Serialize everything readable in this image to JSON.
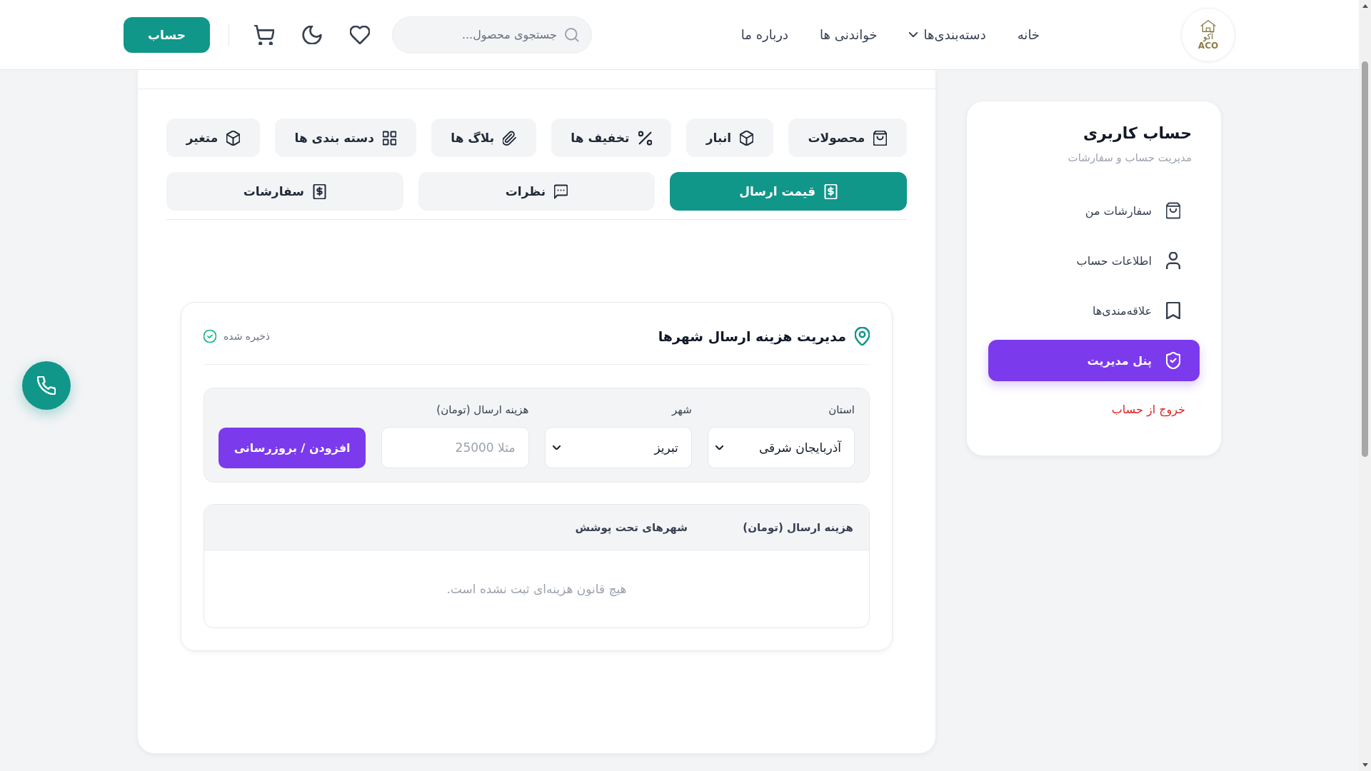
{
  "header": {
    "logo": {
      "name": "آکو",
      "latin": "ACO"
    },
    "nav": [
      {
        "label": "خانه",
        "has_dropdown": false
      },
      {
        "label": "دسته‌بندی‌ها",
        "has_dropdown": true
      },
      {
        "label": "خواندنی ها",
        "has_dropdown": false
      },
      {
        "label": "درباره ما",
        "has_dropdown": false
      }
    ],
    "search": {
      "placeholder": "جستجوی محصول..."
    },
    "account_button": "حساب"
  },
  "sidebar": {
    "title": "حساب کاربری",
    "subtitle": "مدیریت حساب و سفارشات",
    "items": [
      {
        "label": "سفارشات من",
        "selected": false
      },
      {
        "label": "اطلاعات حساب",
        "selected": false
      },
      {
        "label": "علاقه‌مندی‌ها",
        "selected": false
      },
      {
        "label": "پنل مدیریت",
        "selected": true
      }
    ],
    "logout": "خروج از حساب"
  },
  "admin_panel": {
    "tab_rows": [
      [
        {
          "label": "محصولات",
          "selected": false
        },
        {
          "label": "انبار",
          "selected": false
        },
        {
          "label": "تخفیف ها",
          "selected": false
        },
        {
          "label": "بلاگ ها",
          "selected": false
        },
        {
          "label": "دسته بندی ها",
          "selected": false
        },
        {
          "label": "متغیر",
          "selected": false
        }
      ],
      [
        {
          "label": "قیمت ارسال",
          "selected": true
        },
        {
          "label": "نظرات",
          "selected": false
        },
        {
          "label": "سفارشات",
          "selected": false
        }
      ]
    ],
    "shipping_card": {
      "title": "مدیریت هزینه ارسال شهرها",
      "status": "ذخیره شده",
      "form": {
        "province": {
          "label": "استان",
          "value": "آذربایجان شرقی"
        },
        "city": {
          "label": "شهر",
          "value": "تبریز"
        },
        "cost": {
          "label": "هزینه ارسال (تومان)",
          "placeholder": "مثلا 25000"
        },
        "submit_button": "افزودن / بروزرسانی"
      },
      "table": {
        "columns": [
          "هزینه ارسال (تومان)",
          "شهرهای تحت پوشش"
        ],
        "empty_message": "هیچ قانون هزینه‌ای ثبت نشده است."
      }
    }
  }
}
